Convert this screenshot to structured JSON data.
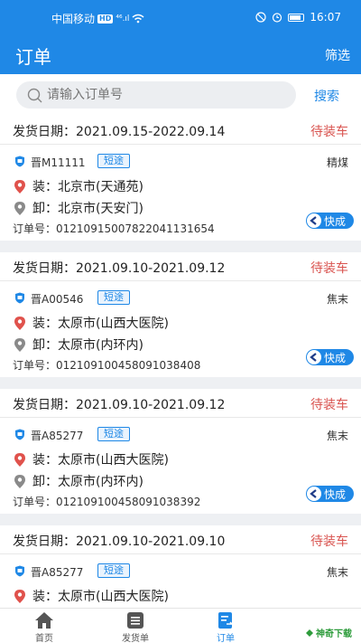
{
  "status_bar": {
    "carrier": "中国移动",
    "hd_badge": "HD",
    "signal": "⁴⁶.ıl",
    "time": "16:07"
  },
  "header": {
    "title": "订单",
    "filter_label": "筛选"
  },
  "search": {
    "placeholder": "请输入订单号",
    "button_label": "搜索"
  },
  "labels": {
    "date_prefix": "发货日期：",
    "load": "装：",
    "unload": "卸：",
    "order_prefix": "订单号："
  },
  "colors": {
    "primary": "#1f88e6",
    "status_red": "#d9534f",
    "load_pin": "#e0524c",
    "unload_pin": "#8a8a8a"
  },
  "orders": [
    {
      "date_range": "2021.09.15-2022.09.14",
      "status": "待装车",
      "plate": "晋M11111",
      "tag": "短途",
      "cargo": "精煤",
      "load": "北京市(天通苑)",
      "unload": "北京市(天安门)",
      "order_no": "0121091500782204113165​4",
      "action": "快成"
    },
    {
      "date_range": "2021.09.10-2021.09.12",
      "status": "待装车",
      "plate": "晋A00546",
      "tag": "短途",
      "cargo": "焦末",
      "load": "太原市(山西大医院)",
      "unload": "太原市(内环内)",
      "order_no": "012109100458091038408",
      "action": "快成"
    },
    {
      "date_range": "2021.09.10-2021.09.12",
      "status": "待装车",
      "plate": "晋A85277",
      "tag": "短途",
      "cargo": "焦末",
      "load": "太原市(山西大医院)",
      "unload": "太原市(内环内)",
      "order_no": "012109100458091038392",
      "action": "快成"
    },
    {
      "date_range": "2021.09.10-2021.09.10",
      "status": "待装车",
      "plate": "晋A85277",
      "tag": "短途",
      "cargo": "焦末",
      "load": "太原市(山西大医院)",
      "unload": "",
      "order_no": "",
      "action": ""
    }
  ],
  "tabs": [
    {
      "label": "首页",
      "icon": "home-icon"
    },
    {
      "label": "发货单",
      "icon": "list-icon"
    },
    {
      "label": "订单",
      "icon": "order-doc-icon",
      "active": true
    }
  ],
  "watermark": "神奇下载"
}
